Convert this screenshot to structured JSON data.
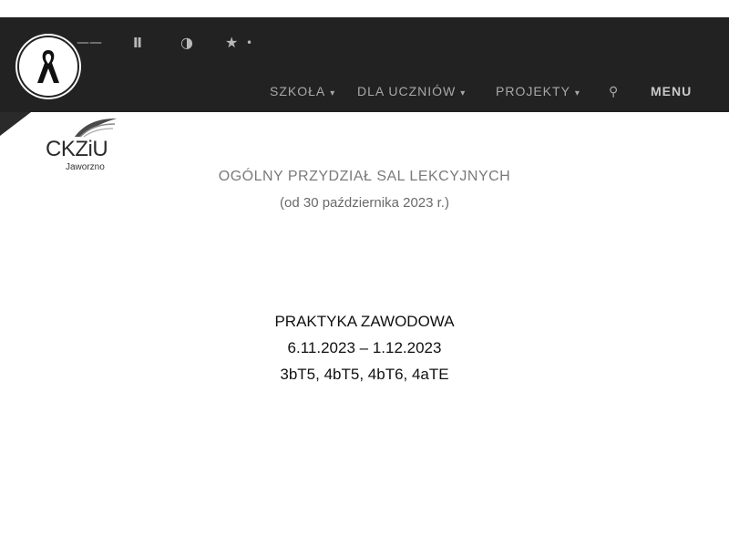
{
  "topbar": {
    "icons": [
      {
        "name": "facebook-icon",
        "glyph": "——"
      },
      {
        "name": "gallery-icon",
        "glyph": "Ⅱ"
      },
      {
        "name": "contrast-icon",
        "glyph": "◑"
      },
      {
        "name": "accessibility-icon",
        "glyph": "★"
      },
      {
        "name": "more-icon",
        "glyph": "•"
      }
    ]
  },
  "nav": {
    "items": [
      {
        "label": "SZKOŁA",
        "has_dropdown": true
      },
      {
        "label": "DLA UCZNIÓW",
        "has_dropdown": true
      },
      {
        "label": "PROJEKTY",
        "has_dropdown": true
      }
    ],
    "menu_label": "MENU",
    "caret": "▾",
    "search_glyph": "⚲"
  },
  "brand": {
    "name": "CKZiU",
    "sub": "Jaworzno"
  },
  "content": {
    "title_line1": "OGÓLNY PRZYDZIAŁ SAL LEKCYJNYCH",
    "title_line2": "(od 30 października 2023 r.)",
    "practice_title": "PRAKTYKA ZAWODOWA",
    "practice_dates": "6.11.2023 – 1.12.2023",
    "practice_classes": "3bT5, 4bT5, 4bT6, 4aTE"
  },
  "colors": {
    "topbar_bg": "#222222",
    "nav_text": "#a8a8a8",
    "accent_text": "#7a7a7a"
  }
}
